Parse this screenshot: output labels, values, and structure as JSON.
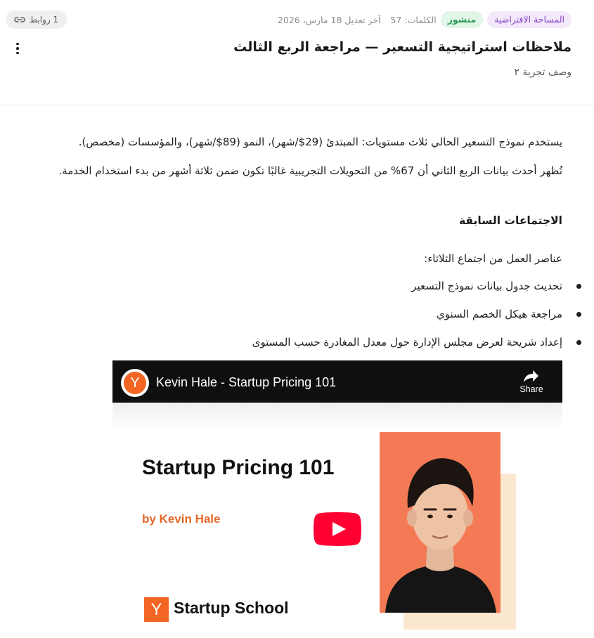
{
  "header": {
    "badges": {
      "workspace": "المساحة الافتراضية",
      "status": "منشور"
    },
    "word_count_label": "الكلمات: 57",
    "modified_label": "آخر تعديل 18 مارس، 2026",
    "links_label": "1 روابط",
    "title": "ملاحظات استراتيجية التسعير — مراجعة الربع الثالث",
    "subtitle": "وصف تجربة ٢"
  },
  "body": {
    "para1": "يستخدم نموذج التسعير الحالي ثلاث مستويات: المبتدئ (29$/شهر)، النمو (89$/شهر)، والمؤسسات (مخصص).",
    "para2": "تُظهر أحدث بيانات الربع الثاني أن 67% من التحويلات التجريبية غالبًا تكون ضمن ثلاثة أشهر من بدء استخدام الخدمة.",
    "section_heading": "الاجتماعات السابقة",
    "para3": "عناصر العمل من اجتماع الثلاثاء:",
    "bullets": [
      "تحديث جدول بيانات نموذج التسعير",
      "مراجعة هيكل الخصم السنوي",
      "إعداد شريحة لعرض مجلس الإدارة حول معدل المغادرة حسب المستوى"
    ]
  },
  "video": {
    "channel_logo_letter": "Y",
    "title": "Kevin Hale - Startup Pricing 101",
    "share_label": "Share",
    "thumbnail": {
      "heading": "Startup Pricing 101",
      "byline": "by Kevin Hale",
      "logo_letter": "Y",
      "logo_text": "Startup School"
    }
  },
  "colors": {
    "workspace_badge": "#8a3fc6",
    "status_badge": "#2a9a55",
    "yc_orange": "#f26522",
    "youtube_red": "#ff0033",
    "photo_background": "#f47a55"
  },
  "icons": [
    "link-icon",
    "more-vertical-icon",
    "share-arrow-icon",
    "youtube-play-icon"
  ]
}
